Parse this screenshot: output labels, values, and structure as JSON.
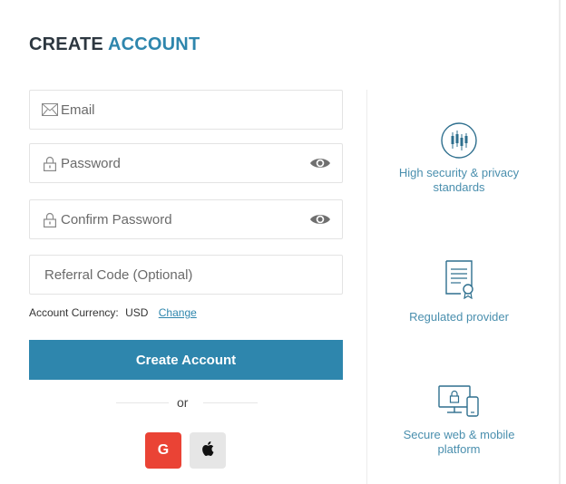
{
  "title": {
    "part1": "CREATE",
    "part2": "ACCOUNT"
  },
  "form": {
    "email_placeholder": "Email",
    "password_placeholder": "Password",
    "confirm_password_placeholder": "Confirm Password",
    "referral_placeholder": "Referral Code (Optional)"
  },
  "currency": {
    "label": "Account Currency:",
    "value": "USD",
    "change_link": "Change"
  },
  "submit_label": "Create Account",
  "or_text": "or",
  "social": {
    "google_label": "G"
  },
  "features": [
    {
      "text": "High security & privacy standards",
      "icon": "candlestick-chart-icon"
    },
    {
      "text": "Regulated provider",
      "icon": "certificate-icon"
    },
    {
      "text": "Secure web & mobile platform",
      "icon": "devices-lock-icon"
    }
  ],
  "colors": {
    "accent": "#2e86ad",
    "title_dark": "#2d3740",
    "google_red": "#ea4335",
    "feature_text": "#4a8fae"
  }
}
